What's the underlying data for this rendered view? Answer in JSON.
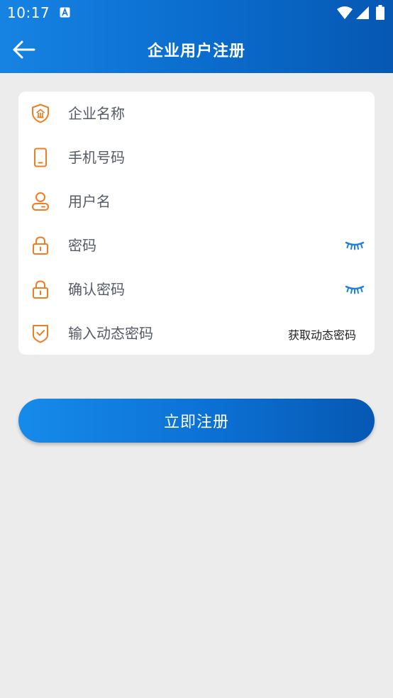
{
  "status_bar": {
    "time": "10:17",
    "notification_icon": "text-a-icon",
    "icons": [
      "wifi-icon",
      "cell-signal-icon",
      "battery-icon"
    ]
  },
  "header": {
    "back_icon": "arrow-left-icon",
    "title": "企业用户注册"
  },
  "form": {
    "company_name": {
      "placeholder": "企业名称",
      "icon": "enterprise-shield-icon"
    },
    "phone": {
      "placeholder": "手机号码",
      "icon": "mobile-phone-icon"
    },
    "username": {
      "placeholder": "用户名",
      "icon": "user-icon"
    },
    "password": {
      "placeholder": "密码",
      "icon": "lock-icon",
      "toggle_icon": "eye-closed-icon"
    },
    "confirm_password": {
      "placeholder": "确认密码",
      "icon": "lock-icon",
      "toggle_icon": "eye-closed-icon"
    },
    "dynamic_code": {
      "placeholder": "输入动态密码",
      "icon": "shield-check-icon",
      "get_code_label": "获取动态密码"
    }
  },
  "submit": {
    "label": "立即注册"
  },
  "colors": {
    "header_start": "#1683e3",
    "header_end": "#0658b2",
    "icon_orange": "#ef7d22",
    "eye_blue": "#1e7fe0",
    "background": "#ececec"
  }
}
